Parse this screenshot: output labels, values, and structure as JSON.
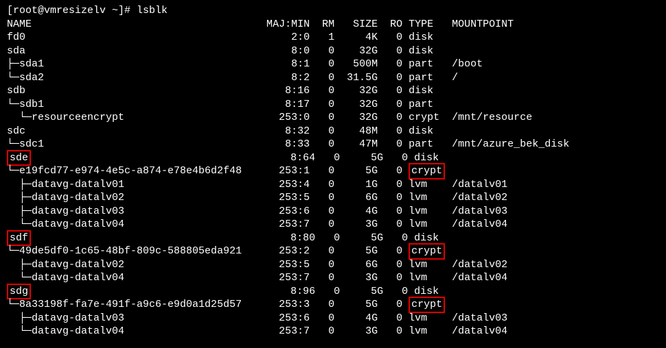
{
  "prompt": "[root@vmresizelv ~]# ",
  "command": "lsblk",
  "header": {
    "name": "NAME",
    "majmin": "MAJ:MIN",
    "rm": "RM",
    "size": "SIZE",
    "ro": "RO",
    "type": "TYPE",
    "mountpoint": "MOUNTPOINT"
  },
  "rows": [
    {
      "tree": "",
      "name": "fd0",
      "maj": "2:0",
      "rm": "1",
      "size": "4K",
      "ro": "0",
      "type": "disk",
      "mount": "",
      "hlName": false,
      "hlType": false
    },
    {
      "tree": "",
      "name": "sda",
      "maj": "8:0",
      "rm": "0",
      "size": "32G",
      "ro": "0",
      "type": "disk",
      "mount": "",
      "hlName": false,
      "hlType": false
    },
    {
      "tree": "├─",
      "name": "sda1",
      "maj": "8:1",
      "rm": "0",
      "size": "500M",
      "ro": "0",
      "type": "part",
      "mount": "/boot",
      "hlName": false,
      "hlType": false
    },
    {
      "tree": "└─",
      "name": "sda2",
      "maj": "8:2",
      "rm": "0",
      "size": "31.5G",
      "ro": "0",
      "type": "part",
      "mount": "/",
      "hlName": false,
      "hlType": false
    },
    {
      "tree": "",
      "name": "sdb",
      "maj": "8:16",
      "rm": "0",
      "size": "32G",
      "ro": "0",
      "type": "disk",
      "mount": "",
      "hlName": false,
      "hlType": false
    },
    {
      "tree": "└─",
      "name": "sdb1",
      "maj": "8:17",
      "rm": "0",
      "size": "32G",
      "ro": "0",
      "type": "part",
      "mount": "",
      "hlName": false,
      "hlType": false
    },
    {
      "tree": "  └─",
      "name": "resourceencrypt",
      "maj": "253:0",
      "rm": "0",
      "size": "32G",
      "ro": "0",
      "type": "crypt",
      "mount": "/mnt/resource",
      "hlName": false,
      "hlType": false
    },
    {
      "tree": "",
      "name": "sdc",
      "maj": "8:32",
      "rm": "0",
      "size": "48M",
      "ro": "0",
      "type": "disk",
      "mount": "",
      "hlName": false,
      "hlType": false
    },
    {
      "tree": "└─",
      "name": "sdc1",
      "maj": "8:33",
      "rm": "0",
      "size": "47M",
      "ro": "0",
      "type": "part",
      "mount": "/mnt/azure_bek_disk",
      "hlName": false,
      "hlType": false
    },
    {
      "tree": "",
      "name": "sde",
      "maj": "8:64",
      "rm": "0",
      "size": "5G",
      "ro": "0",
      "type": "disk",
      "mount": "",
      "hlName": true,
      "hlType": false
    },
    {
      "tree": "└─",
      "name": "e19fcd77-e974-4e5c-a874-e78e4b6d2f48",
      "maj": "253:1",
      "rm": "0",
      "size": "5G",
      "ro": "0",
      "type": "crypt",
      "mount": "",
      "hlName": false,
      "hlType": true
    },
    {
      "tree": "  ├─",
      "name": "datavg-datalv01",
      "maj": "253:4",
      "rm": "0",
      "size": "1G",
      "ro": "0",
      "type": "lvm",
      "mount": "/datalv01",
      "hlName": false,
      "hlType": false
    },
    {
      "tree": "  ├─",
      "name": "datavg-datalv02",
      "maj": "253:5",
      "rm": "0",
      "size": "6G",
      "ro": "0",
      "type": "lvm",
      "mount": "/datalv02",
      "hlName": false,
      "hlType": false
    },
    {
      "tree": "  ├─",
      "name": "datavg-datalv03",
      "maj": "253:6",
      "rm": "0",
      "size": "4G",
      "ro": "0",
      "type": "lvm",
      "mount": "/datalv03",
      "hlName": false,
      "hlType": false
    },
    {
      "tree": "  └─",
      "name": "datavg-datalv04",
      "maj": "253:7",
      "rm": "0",
      "size": "3G",
      "ro": "0",
      "type": "lvm",
      "mount": "/datalv04",
      "hlName": false,
      "hlType": false
    },
    {
      "tree": "",
      "name": "sdf",
      "maj": "8:80",
      "rm": "0",
      "size": "5G",
      "ro": "0",
      "type": "disk",
      "mount": "",
      "hlName": true,
      "hlType": false
    },
    {
      "tree": "└─",
      "name": "49de5df0-1c65-48bf-809c-588805eda921",
      "maj": "253:2",
      "rm": "0",
      "size": "5G",
      "ro": "0",
      "type": "crypt",
      "mount": "",
      "hlName": false,
      "hlType": true
    },
    {
      "tree": "  ├─",
      "name": "datavg-datalv02",
      "maj": "253:5",
      "rm": "0",
      "size": "6G",
      "ro": "0",
      "type": "lvm",
      "mount": "/datalv02",
      "hlName": false,
      "hlType": false
    },
    {
      "tree": "  └─",
      "name": "datavg-datalv04",
      "maj": "253:7",
      "rm": "0",
      "size": "3G",
      "ro": "0",
      "type": "lvm",
      "mount": "/datalv04",
      "hlName": false,
      "hlType": false
    },
    {
      "tree": "",
      "name": "sdg",
      "maj": "8:96",
      "rm": "0",
      "size": "5G",
      "ro": "0",
      "type": "disk",
      "mount": "",
      "hlName": true,
      "hlType": false
    },
    {
      "tree": "└─",
      "name": "8a33198f-fa7e-491f-a9c6-e9d0a1d25d57",
      "maj": "253:3",
      "rm": "0",
      "size": "5G",
      "ro": "0",
      "type": "crypt",
      "mount": "",
      "hlName": false,
      "hlType": true
    },
    {
      "tree": "  ├─",
      "name": "datavg-datalv03",
      "maj": "253:6",
      "rm": "0",
      "size": "4G",
      "ro": "0",
      "type": "lvm",
      "mount": "/datalv03",
      "hlName": false,
      "hlType": false
    },
    {
      "tree": "  └─",
      "name": "datavg-datalv04",
      "maj": "253:7",
      "rm": "0",
      "size": "3G",
      "ro": "0",
      "type": "lvm",
      "mount": "/datalv04",
      "hlName": false,
      "hlType": false
    }
  ],
  "widths": {
    "nameCol": 42,
    "maj": 7,
    "rm": 3,
    "size": 6,
    "ro": 3,
    "type": 6
  }
}
